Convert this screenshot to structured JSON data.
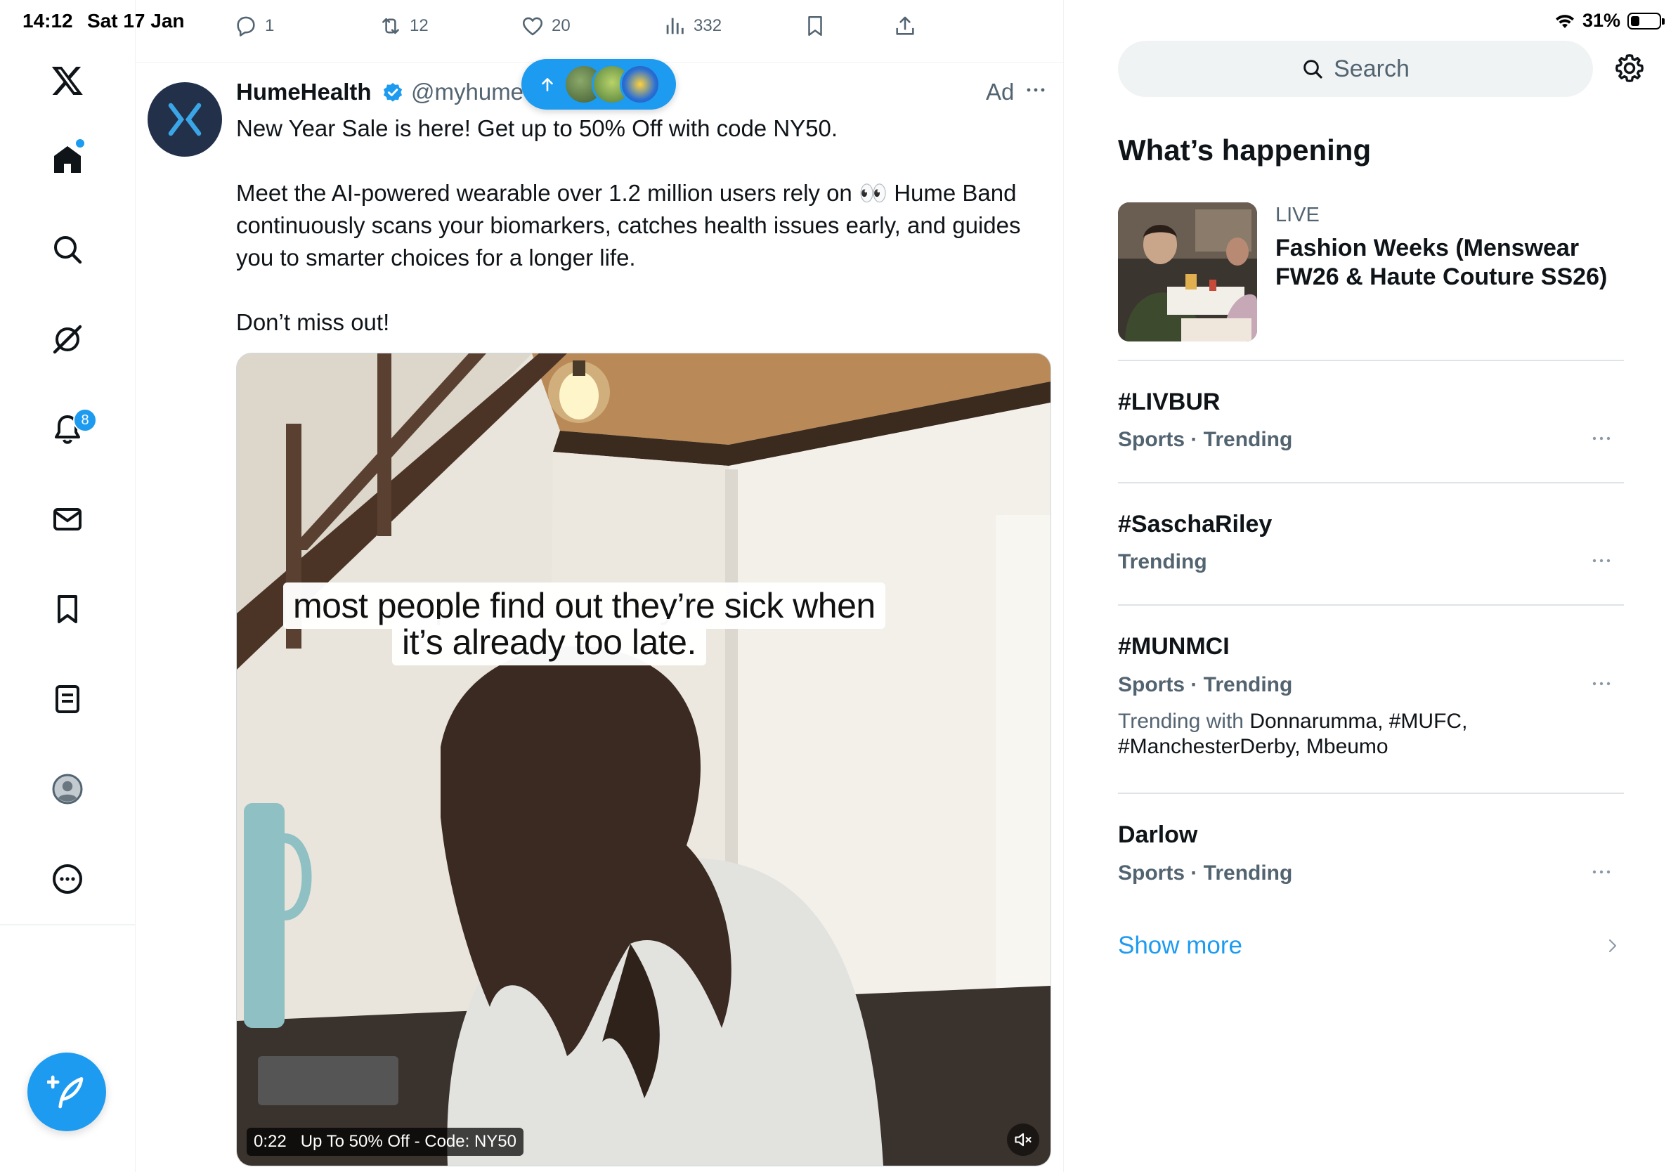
{
  "status_bar": {
    "time": "14:12",
    "date": "Sat 17 Jan",
    "battery": "31%",
    "battery_level": 0.31
  },
  "nav": {
    "home_badge": true,
    "notifications_badge": "8"
  },
  "tweet_actions_top": {
    "replies": "1",
    "retweets": "12",
    "likes": "20",
    "views": "332"
  },
  "tweet": {
    "author": "HumeHealth",
    "handle": "@myhume",
    "ad_label": "Ad",
    "paragraphs": [
      "New Year Sale is here! Get up to 50% Off with code NY50.",
      "Meet the AI-powered wearable over 1.2 million users rely on 👀 Hume Band continuously scans your biomarkers, catches health issues early, and guides you to smarter choices for a longer life.",
      "Don’t miss out!"
    ],
    "media": {
      "caption_line1": "most people find out they’re sick when",
      "caption_line2": "it’s already too late.",
      "duration": "0:22",
      "promo": "Up To 50% Off - Code: NY50"
    }
  },
  "sidebar": {
    "search_placeholder": "Search",
    "section_title": "What’s happening",
    "live": {
      "label": "LIVE",
      "title": "Fashion Weeks (Menswear FW26 & Haute Couture SS26)"
    },
    "trends": [
      {
        "title": "#LIVBUR",
        "meta": "Sports · Trending"
      },
      {
        "title": "#SaschaRiley",
        "meta": "Trending"
      },
      {
        "title": "#MUNMCI",
        "meta": "Sports · Trending",
        "with_label": "Trending with",
        "with_items": "Donnarumma, #MUFC, #ManchesterDerby, Mbeumo"
      },
      {
        "title": "Darlow",
        "meta": "Sports · Trending"
      }
    ],
    "show_more": "Show more"
  },
  "colors": {
    "accent": "#1d9bf0",
    "text": "#0f1419",
    "secondary": "#536471",
    "border": "#eff3f4"
  }
}
